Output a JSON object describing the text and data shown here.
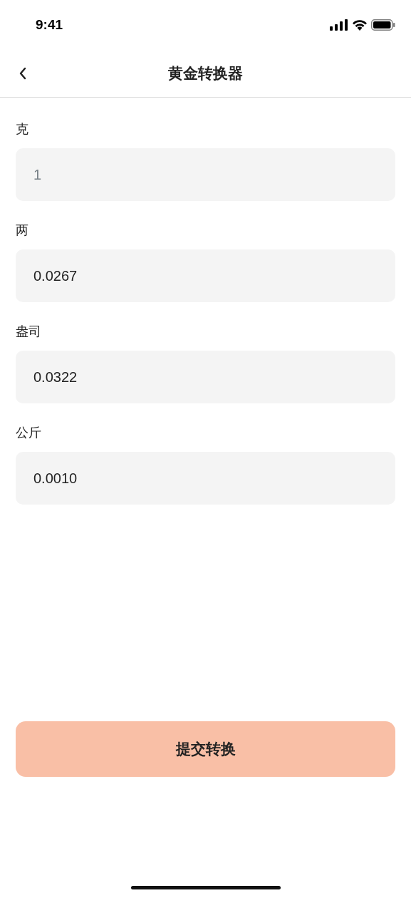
{
  "status_bar": {
    "time": "9:41"
  },
  "nav": {
    "title": "黄金转换器"
  },
  "fields": [
    {
      "label": "克",
      "placeholder": "1"
    },
    {
      "label": "两",
      "value": "0.0267"
    },
    {
      "label": "盎司",
      "value": "0.0322"
    },
    {
      "label": "公斤",
      "value": "0.0010"
    }
  ],
  "submit_button": {
    "label": "提交转换"
  }
}
